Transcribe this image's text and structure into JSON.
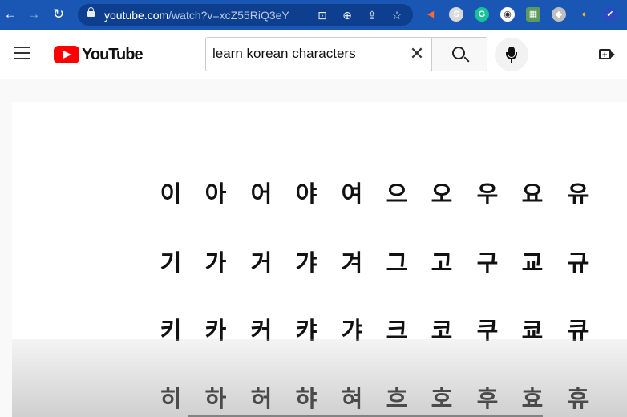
{
  "browser": {
    "url_host": "youtube.com",
    "url_path": "/watch?v=xcZ55RiQ3eY",
    "extensions": [
      {
        "name": "extension-icon-1",
        "glyph": "S",
        "color": "#d9d9d9"
      },
      {
        "name": "extension-icon-2",
        "glyph": "G",
        "color": "#15c39a"
      },
      {
        "name": "extension-icon-3",
        "glyph": "◉",
        "color": "#ffffff"
      },
      {
        "name": "extension-icon-4",
        "glyph": "▦",
        "color": "#5d9b5d"
      },
      {
        "name": "extension-icon-5",
        "glyph": "◆",
        "color": "#bfbfbf"
      },
      {
        "name": "extension-icon-6",
        "glyph": "◐",
        "color": "#f5b82e"
      },
      {
        "name": "extension-icon-7",
        "glyph": "✔",
        "color": "#2a4bbf"
      }
    ]
  },
  "youtube": {
    "logo_text": "YouTube",
    "search_value": "learn korean characters",
    "clear_glyph": "✕",
    "brand_color": "#ff0000"
  },
  "video": {
    "rows": [
      [
        "이",
        "아",
        "어",
        "야",
        "여",
        "으",
        "오",
        "우",
        "요",
        "유"
      ],
      [
        "기",
        "가",
        "거",
        "갸",
        "겨",
        "그",
        "고",
        "구",
        "교",
        "규"
      ],
      [
        "키",
        "카",
        "커",
        "캬",
        "갸",
        "크",
        "코",
        "쿠",
        "쿄",
        "큐"
      ],
      [
        "히",
        "하",
        "허",
        "햐",
        "혀",
        "흐",
        "호",
        "후",
        "효",
        "휴"
      ]
    ]
  }
}
